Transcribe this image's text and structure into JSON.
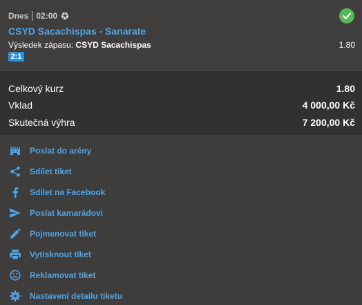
{
  "ticket": {
    "day": "Dnes",
    "time": "02:00",
    "sport_icon": "soccer-ball-icon",
    "status_icon": "check-circle-icon",
    "status_color": "#58b755",
    "match": "CSYD Sacachispas - Sanarate",
    "market_label": "Výsledek zápasu:",
    "market_pick": "CSYD Sacachispas",
    "odd": "1.80",
    "score": "2:1"
  },
  "summary": {
    "total_odds_label": "Celkový kurz",
    "total_odds_value": "1.80",
    "stake_label": "Vklad",
    "stake_value": "4 000,00 Kč",
    "win_label": "Skutečná výhra",
    "win_value": "7 200,00 Kč"
  },
  "actions": [
    {
      "label": "Poslat do arény",
      "icon": "arena-icon"
    },
    {
      "label": "Sdílet tiket",
      "icon": "share-icon"
    },
    {
      "label": "Sdílet na Facebook",
      "icon": "facebook-icon"
    },
    {
      "label": "Poslat kamarádovi",
      "icon": "send-icon"
    },
    {
      "label": "Pojmenovat tiket",
      "icon": "pencil-icon"
    },
    {
      "label": "Vytisknout tiket",
      "icon": "printer-icon"
    },
    {
      "label": "Reklamovat tiket",
      "icon": "sad-face-icon"
    },
    {
      "label": "Nastavení detailu tiketu",
      "icon": "gear-icon"
    }
  ],
  "colors": {
    "accent": "#4fa3e6",
    "background": "#3f3d3b",
    "summary_background": "#33312f",
    "score_badge": "#2f8fd8"
  }
}
